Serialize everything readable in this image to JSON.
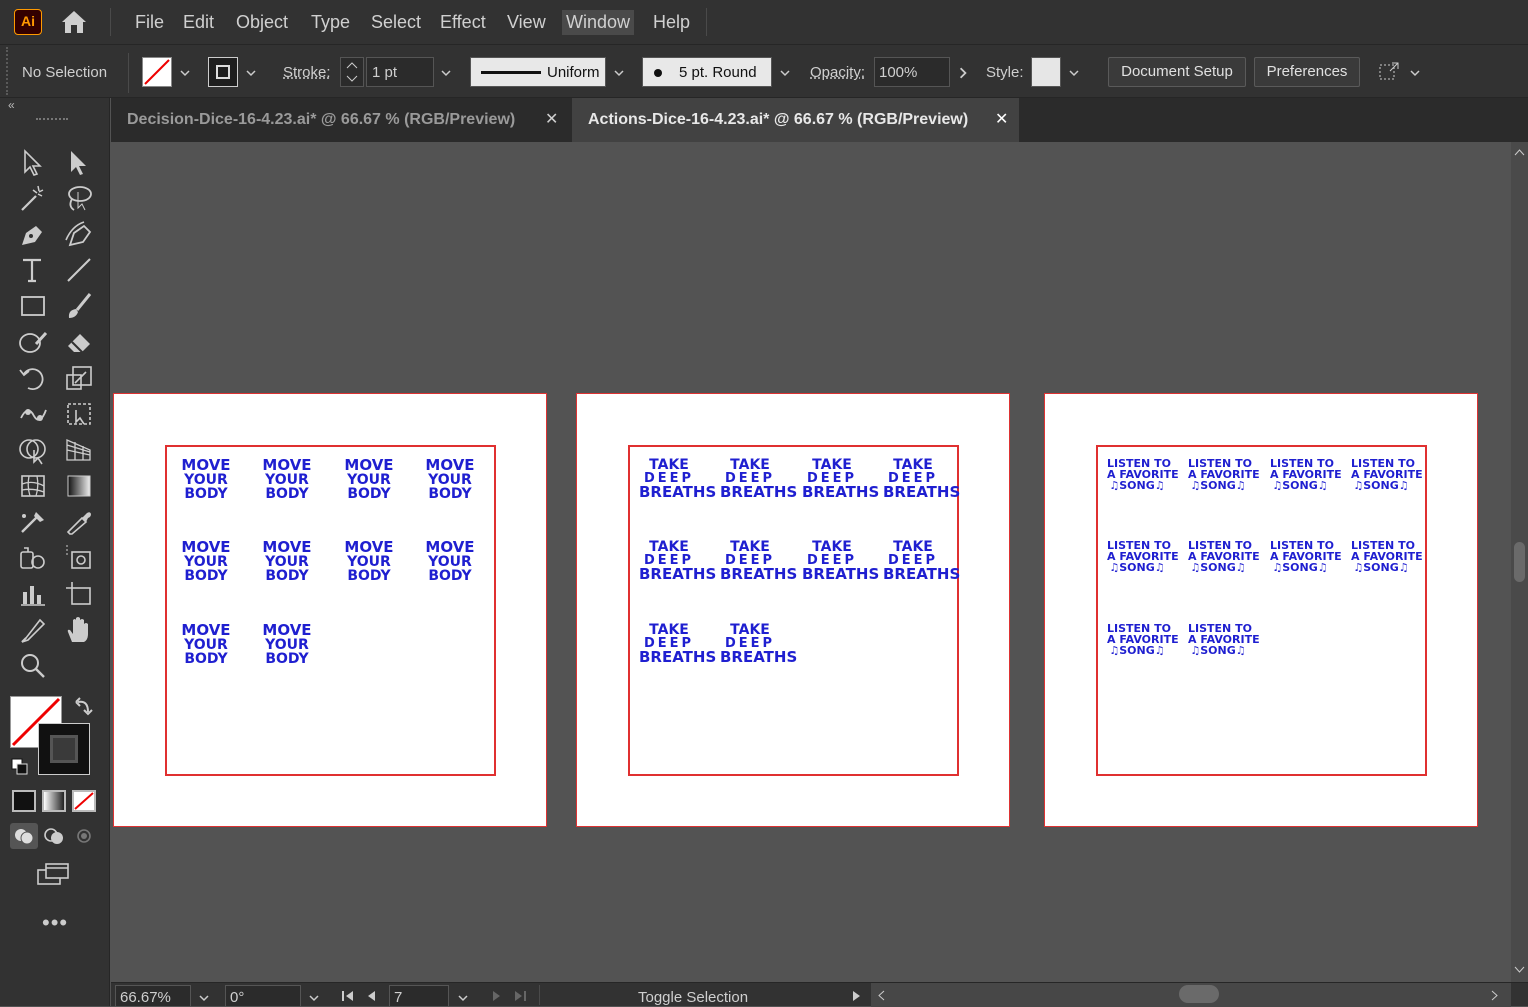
{
  "app": {
    "logo_text": "Ai"
  },
  "menu": {
    "items": [
      "File",
      "Edit",
      "Object",
      "Type",
      "Select",
      "Effect",
      "View",
      "Window",
      "Help"
    ],
    "active": "Window"
  },
  "control": {
    "selection": "No Selection",
    "stroke_label": "Stroke:",
    "stroke_weight": "1 pt",
    "profile": "Uniform",
    "brush": "5 pt. Round",
    "opacity_label": "Opacity:",
    "opacity": "100%",
    "style_label": "Style:",
    "document_setup": "Document Setup",
    "preferences": "Preferences"
  },
  "tabs": [
    {
      "label": "Decision-Dice-16-4.23.ai* @ 66.67 % (RGB/Preview)",
      "active": false,
      "close": "✕"
    },
    {
      "label": "Actions-Dice-16-4.23.ai* @ 66.67 % (RGB/Preview)",
      "active": true,
      "close": "✕"
    }
  ],
  "artboards": [
    {
      "sticker": [
        "MOVE",
        "YOUR",
        "BODY"
      ],
      "count": 10
    },
    {
      "sticker": [
        "TAKE",
        "DEEP",
        "BREATHS"
      ],
      "count": 10
    },
    {
      "sticker": [
        "LISTEN TO",
        "A FAVORITE",
        "♫SONG♫"
      ],
      "count": 10
    }
  ],
  "status": {
    "zoom": "66.67%",
    "rotation": "0°",
    "artboard_number": "7",
    "toggle": "Toggle Selection"
  },
  "colors": {
    "sticker_text": "#1f1fd0",
    "artboard_border": "#e03030",
    "accent_logo": "#ff9a00"
  }
}
